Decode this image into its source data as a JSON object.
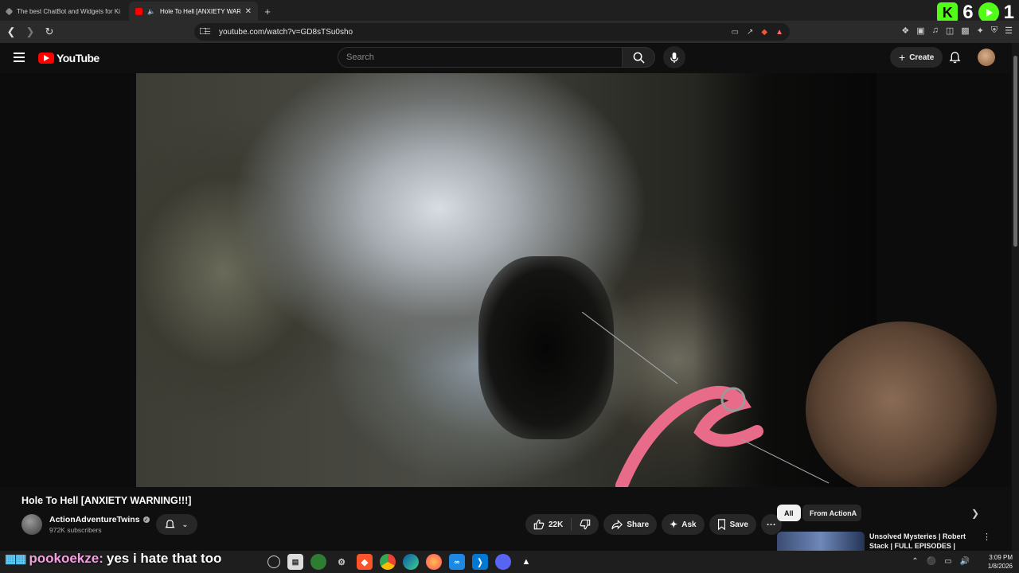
{
  "browser": {
    "tabs": [
      {
        "title": "The best ChatBot and Widgets for Ki",
        "active": false
      },
      {
        "title": "Hole To Hell [ANXIETY WARN",
        "active": true
      }
    ],
    "url": "youtube.com/watch?v=GD8sTSu0sho",
    "overlay_counts": [
      "6",
      "1"
    ]
  },
  "youtube": {
    "logo": "YouTube",
    "search_placeholder": "Search",
    "create_label": "Create",
    "video": {
      "title": "Hole To Hell [ANXIETY WARNING!!!]",
      "channel": "ActionAdventureTwins",
      "subscribers": "972K subscribers",
      "likes": "22K",
      "share_label": "Share",
      "ask_label": "Ask",
      "save_label": "Save"
    },
    "chips": [
      "All",
      "From ActionA"
    ],
    "recommendation": {
      "title": "Unsolved Mysteries | Robert Stack | FULL EPISODES |"
    }
  },
  "stream_chat": {
    "user": "pookoekze:",
    "message": "yes i hate that too"
  },
  "taskbar": {
    "time": "3:09 PM",
    "date": "1/8/2026"
  },
  "colors": {
    "yt_red": "#ff0000",
    "kick_green": "#53fc18",
    "chat_user": "#f4a0e0"
  }
}
